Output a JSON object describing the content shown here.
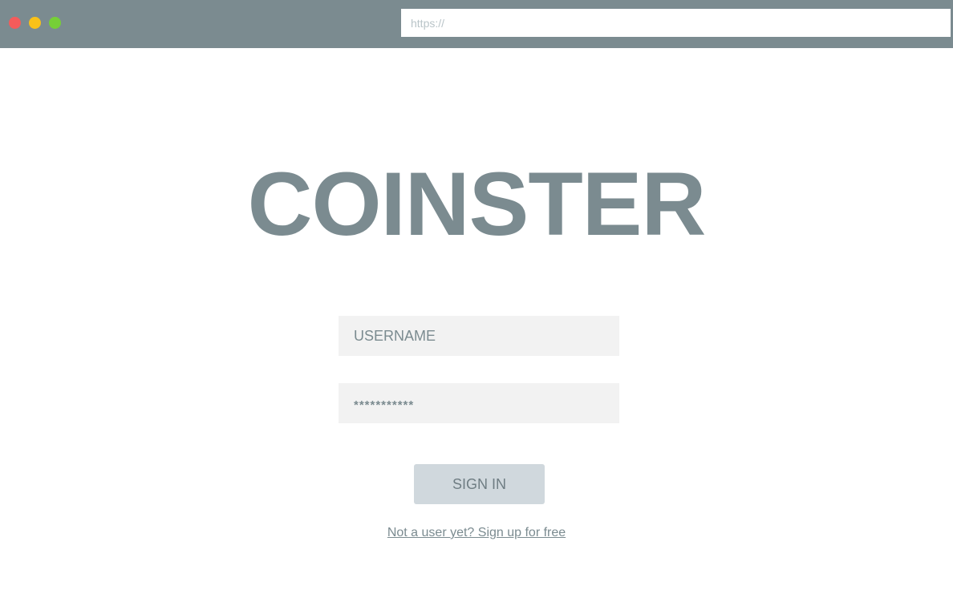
{
  "browser": {
    "address_placeholder": "https://",
    "address_value": "",
    "window_controls": [
      {
        "name": "close",
        "color": "#f45b5b"
      },
      {
        "name": "minimize",
        "color": "#f9c118"
      },
      {
        "name": "maximize",
        "color": "#76cf37"
      }
    ],
    "bar_color": "#7b8b90"
  },
  "logo": {
    "text": "COINSTER",
    "color": "#7b8b90"
  },
  "login_form": {
    "username_placeholder": "USERNAME",
    "username_value": "",
    "password_value": "***********",
    "signin_label": "SIGN IN",
    "signin_button_color": "#d0d8dd",
    "signup_link_text": "Not a user yet? Sign up for free"
  }
}
